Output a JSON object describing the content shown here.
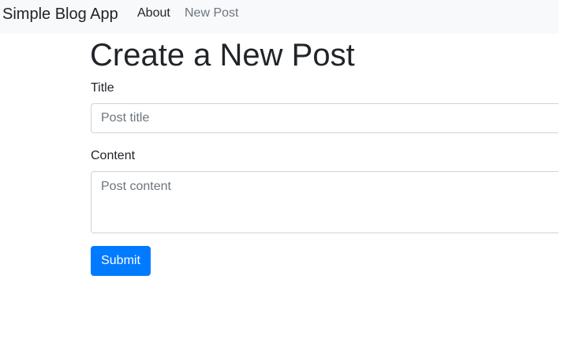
{
  "navbar": {
    "brand": "Simple Blog App",
    "links": [
      {
        "label": "About"
      },
      {
        "label": "New Post"
      }
    ]
  },
  "page": {
    "title": "Create a New Post"
  },
  "form": {
    "title_label": "Title",
    "title_placeholder": "Post title",
    "content_label": "Content",
    "content_placeholder": "Post content",
    "submit_label": "Submit"
  }
}
